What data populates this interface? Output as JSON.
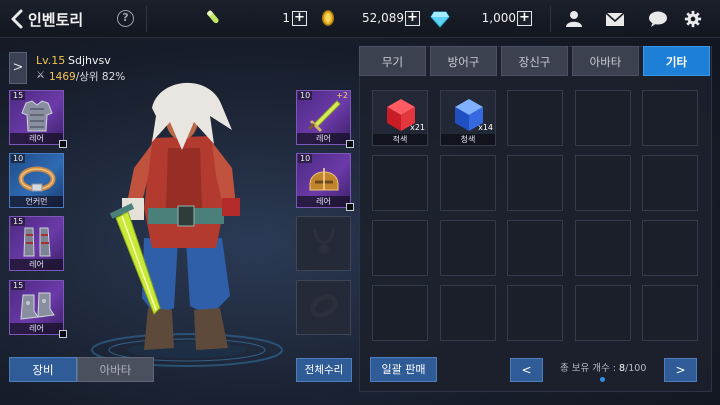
{
  "header": {
    "title": "인벤토리",
    "help_label": "?",
    "resources": [
      {
        "name": "stamina",
        "value": "1"
      },
      {
        "name": "gold",
        "value": "52,089"
      },
      {
        "name": "gem",
        "value": "1,000"
      }
    ]
  },
  "character": {
    "level": "Lv.15",
    "name": "Sdjhvsv",
    "power": "1469",
    "rank": "/상위 82%"
  },
  "left_slots": [
    {
      "level": "15",
      "grade": "레어",
      "rarity": "purple",
      "icon": "armor-icon"
    },
    {
      "level": "10",
      "grade": "언커먼",
      "rarity": "blue",
      "icon": "belt-icon"
    },
    {
      "level": "15",
      "grade": "레어",
      "rarity": "purple",
      "icon": "gauntlet-icon"
    },
    {
      "level": "15",
      "grade": "레어",
      "rarity": "purple",
      "icon": "boots-icon"
    }
  ],
  "right_slots": [
    {
      "level": "10",
      "grade": "레어",
      "rarity": "purple",
      "icon": "sword-icon",
      "star": "+2"
    },
    {
      "level": "10",
      "grade": "레어",
      "rarity": "purple",
      "icon": "helmet-icon"
    },
    {
      "level": "",
      "grade": "",
      "rarity": "empty",
      "icon": "necklace-slot-icon"
    },
    {
      "level": "",
      "grade": "",
      "rarity": "empty",
      "icon": "ring-slot-icon"
    }
  ],
  "character_tabs": {
    "equip": "장비",
    "avatar": "아바타"
  },
  "repair_all": "전체수리",
  "inventory": {
    "tabs": [
      "무기",
      "방어구",
      "장신구",
      "아바타",
      "기타"
    ],
    "active_tab": "기타",
    "items": [
      {
        "name": "적색",
        "qty": "x21",
        "color": "#e0262e"
      },
      {
        "name": "청색",
        "qty": "x14",
        "color": "#2f6fe0"
      }
    ],
    "bulk_sell": "일괄 판매",
    "count_label": "총 보유 개수 : ",
    "count_current": "8",
    "count_max": "/100",
    "prev": "<",
    "next": ">"
  }
}
